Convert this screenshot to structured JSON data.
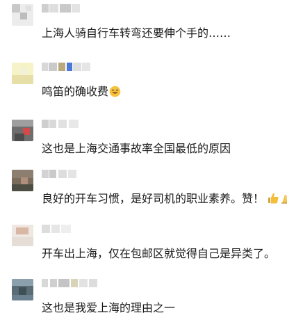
{
  "comments": [
    {
      "username": "",
      "text": "上海人骑自行车转弯还要伸个手的……",
      "emoji": "",
      "avatar_icon": "blurred-avatar-icon"
    },
    {
      "username": "",
      "text": "鸣笛的确收费",
      "emoji": "grinning-sweat-emoji",
      "avatar_icon": "blurred-avatar-icon"
    },
    {
      "username": "",
      "text": "这也是上海交通事故率全国最低的原因",
      "emoji": "",
      "avatar_icon": "blurred-avatar-icon"
    },
    {
      "username": "",
      "text": "良好的开车习惯，是好司机的职业素养。赞！",
      "emoji": "thumbs-up-and-praying-hands-emoji",
      "avatar_icon": "blurred-avatar-icon"
    },
    {
      "username": "",
      "text": "开车出上海，仅在包邮区就觉得自己是异类了。",
      "emoji": "",
      "avatar_icon": "blurred-avatar-icon"
    },
    {
      "username": "",
      "text": "这也是我爱上海的理由之一",
      "emoji": "",
      "avatar_icon": "blurred-avatar-icon"
    }
  ]
}
